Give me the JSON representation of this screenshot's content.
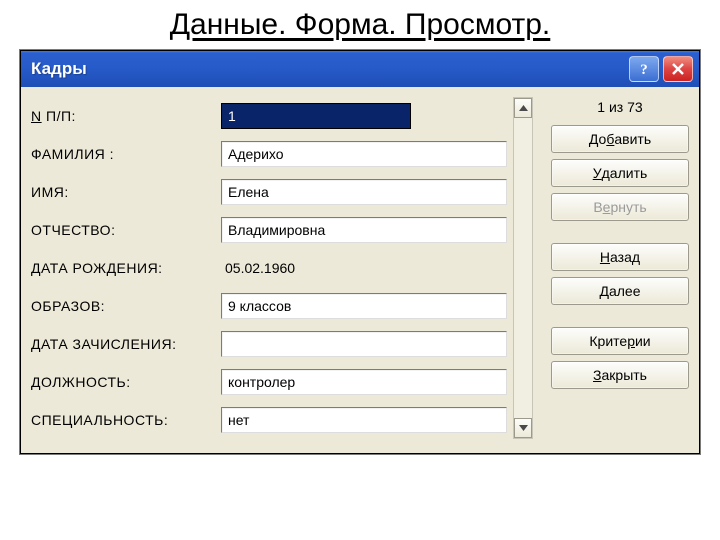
{
  "slide": {
    "title": "Данные. Форма. Просмотр."
  },
  "titlebar": {
    "title": "Кадры",
    "help_aria": "Help",
    "close_aria": "Close"
  },
  "counter": {
    "text": "1 из 73"
  },
  "labels": {
    "npp_pre": "",
    "npp_u": "N",
    "npp_post": " П/П:",
    "familia": "ФАМИЛИЯ    :",
    "imya": "ИМЯ:",
    "otchestvo": "ОТЧЕСТВО:",
    "dob": "ДАТА РОЖДЕНИЯ:",
    "obrazov": "ОБРАЗОВ:",
    "enroll": "ДАТА ЗАЧИСЛЕНИЯ:",
    "position": "ДОЛЖНОСТЬ:",
    "specialty": "СПЕЦИАЛЬНОСТЬ:"
  },
  "values": {
    "npp": "1",
    "familia": "Адерихо",
    "imya": "Елена",
    "otchestvo": "Владимировна",
    "dob": "05.02.1960",
    "obrazov": "9 классов",
    "enroll": "",
    "position": "контролер",
    "specialty": "нет"
  },
  "buttons": {
    "add_pre": "До",
    "add_u": "б",
    "add_post": "авить",
    "delete_pre": "",
    "delete_u": "У",
    "delete_post": "далить",
    "return_pre": "В",
    "return_u": "е",
    "return_post": "рнуть",
    "back_pre": "",
    "back_u": "Н",
    "back_post": "азад",
    "next_pre": "",
    "next_u": "Д",
    "next_post": "алее",
    "criteria_pre": "Крите",
    "criteria_u": "р",
    "criteria_post": "ии",
    "close_pre": "",
    "close_u": "З",
    "close_post": "акрыть"
  }
}
